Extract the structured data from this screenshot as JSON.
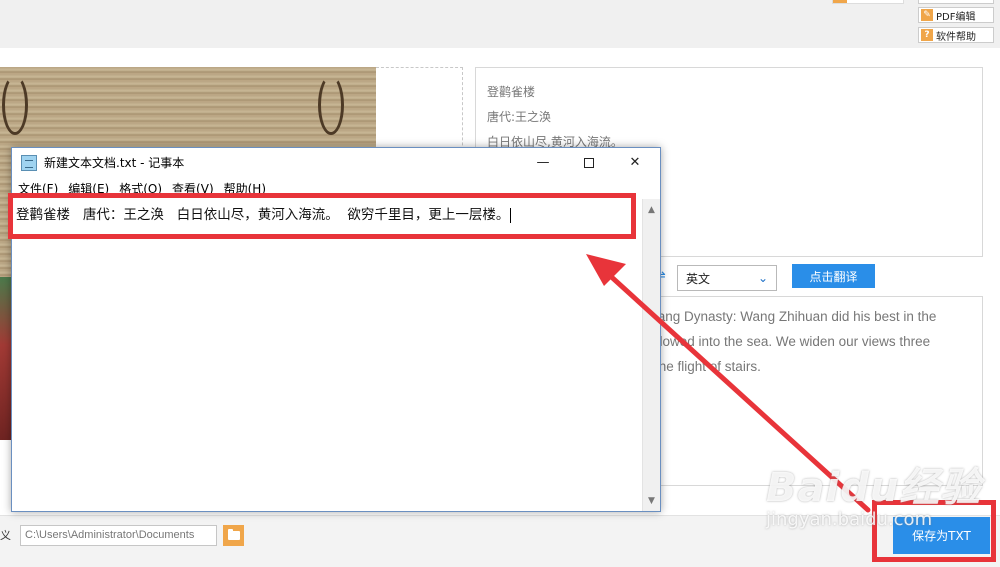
{
  "side_buttons": [
    {
      "icon": "pencil-icon",
      "label": "PDF编辑"
    },
    {
      "icon": "help-icon",
      "label": "软件帮助"
    }
  ],
  "ocr_result": {
    "lines": [
      "登鹳雀楼",
      "唐代:王之涣",
      "白日依山尽,黄河入海流。"
    ]
  },
  "translate": {
    "language": "英文",
    "button_label": "点击翻译",
    "result_lines": [
      "n Tang Dynasty: Wang Zhihuan did his best in the",
      "er flowed into the sea. We widen our views three",
      "g one flight of stairs."
    ]
  },
  "output": {
    "label": "义",
    "path": "C:\\Users\\Administrator\\Documents",
    "save_button_label": "保存为TXT"
  },
  "notepad": {
    "title": "新建文本文档.txt - 记事本",
    "menu": [
      "文件(F)",
      "编辑(E)",
      "格式(O)",
      "查看(V)",
      "帮助(H)"
    ],
    "content": "登鹳雀楼   唐代：王之涣   白日依山尽，黄河入海流。  欲穷千里目，更上一层楼。"
  },
  "watermark": {
    "main": "Baidu经验",
    "sub": "jingyan.baidu.com"
  },
  "colors": {
    "accent_blue": "#2a8ee8",
    "accent_orange": "#f0a64a",
    "annotation_red": "#e8343a"
  }
}
